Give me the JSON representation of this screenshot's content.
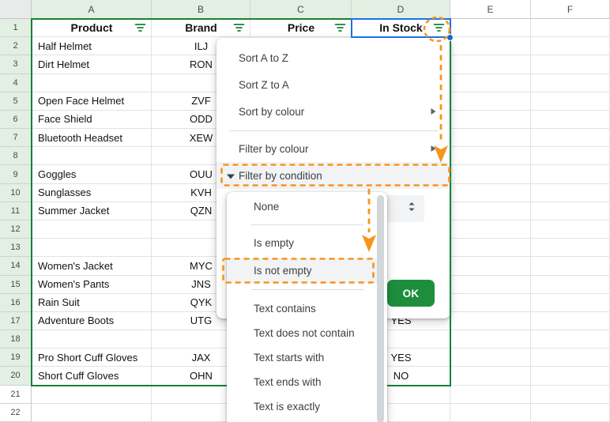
{
  "spreadsheet": {
    "column_letters": [
      "A",
      "B",
      "C",
      "D",
      "E",
      "F"
    ],
    "filter_range": {
      "columns": [
        "A",
        "B",
        "C",
        "D"
      ],
      "first_row": 1,
      "last_row": 20
    },
    "selected_cell": "D1",
    "header_row": {
      "n": "1",
      "cells": [
        "Product",
        "Brand",
        "Price",
        "In Stock"
      ]
    },
    "rows": [
      {
        "n": "2",
        "a": "Half Helmet",
        "b": "ILJ",
        "d": ""
      },
      {
        "n": "3",
        "a": "Dirt Helmet",
        "b": "RON",
        "d": ""
      },
      {
        "n": "4",
        "a": "",
        "b": "",
        "d": ""
      },
      {
        "n": "5",
        "a": "Open Face Helmet",
        "b": "ZVF",
        "d": ""
      },
      {
        "n": "6",
        "a": "Face Shield",
        "b": "ODD",
        "d": ""
      },
      {
        "n": "7",
        "a": "Bluetooth Headset",
        "b": "XEW",
        "d": ""
      },
      {
        "n": "8",
        "a": "",
        "b": "",
        "d": ""
      },
      {
        "n": "9",
        "a": "Goggles",
        "b": "OUU",
        "d": ""
      },
      {
        "n": "10",
        "a": "Sunglasses",
        "b": "KVH",
        "d": ""
      },
      {
        "n": "11",
        "a": "Summer Jacket",
        "b": "QZN",
        "d": ""
      },
      {
        "n": "12",
        "a": "",
        "b": "",
        "d": ""
      },
      {
        "n": "13",
        "a": "",
        "b": "",
        "d": ""
      },
      {
        "n": "14",
        "a": "Women's Jacket",
        "b": "MYC",
        "d": ""
      },
      {
        "n": "15",
        "a": "Women's Pants",
        "b": "JNS",
        "d": ""
      },
      {
        "n": "16",
        "a": "Rain Suit",
        "b": "QYK",
        "d": ""
      },
      {
        "n": "17",
        "a": "Adventure Boots",
        "b": "UTG",
        "d": "YES"
      },
      {
        "n": "18",
        "a": "",
        "b": "",
        "d": ""
      },
      {
        "n": "19",
        "a": "Pro Short Cuff Gloves",
        "b": "JAX",
        "d": "YES"
      },
      {
        "n": "20",
        "a": "Short Cuff Gloves",
        "b": "OHN",
        "d": "NO"
      },
      {
        "n": "21",
        "a": "",
        "b": "",
        "d": ""
      },
      {
        "n": "22",
        "a": "",
        "b": "",
        "d": ""
      }
    ]
  },
  "filter_menu": {
    "items": [
      {
        "label": "Sort A to Z"
      },
      {
        "label": "Sort Z to A"
      },
      {
        "label": "Sort by colour",
        "has_submenu": true
      },
      {
        "divider": true
      },
      {
        "label": "Filter by colour",
        "has_submenu": true
      },
      {
        "label": "Filter by condition",
        "expanded": true,
        "highlighted": true
      }
    ],
    "ok_label": "OK"
  },
  "condition_menu": {
    "items": [
      {
        "label": "None"
      },
      {
        "divider": true
      },
      {
        "label": "Is empty"
      },
      {
        "label": "Is not empty",
        "highlighted": true
      },
      {
        "divider": true
      },
      {
        "label": "Text contains"
      },
      {
        "label": "Text does not contain"
      },
      {
        "label": "Text starts with"
      },
      {
        "label": "Text ends with"
      },
      {
        "label": "Text is exactly"
      }
    ]
  },
  "colors": {
    "filter_icon_green": "#188038",
    "range_border_green": "#188038",
    "ok_button_green": "#1e8e3e",
    "selection_blue": "#1a73e8",
    "header_tint_green": "#e2efe2",
    "annotation_orange": "#f7941e"
  }
}
